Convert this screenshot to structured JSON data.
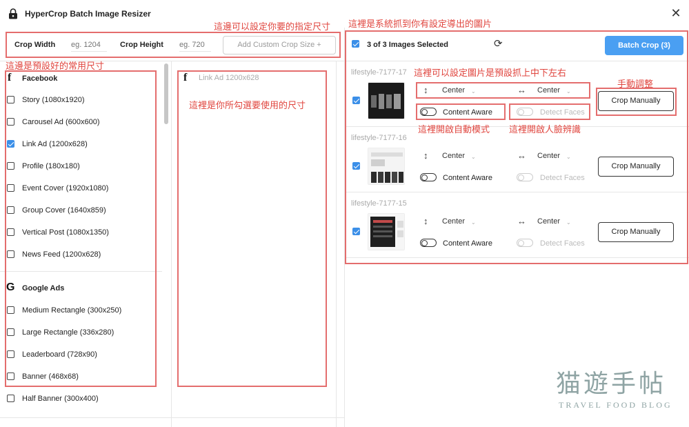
{
  "window": {
    "title": "HyperCrop Batch Image Resizer",
    "close_glyph": "✕"
  },
  "toolbar": {
    "crop_width_label": "Crop Width",
    "crop_width_placeholder": "eg. 1204",
    "crop_height_label": "Crop Height",
    "crop_height_placeholder": "eg. 720",
    "add_custom_label": "Add Custom Crop Size +"
  },
  "sizes": {
    "facebook": {
      "heading": "Facebook",
      "icon": "facebook-f-icon",
      "items": [
        {
          "label": "Story (1080x1920)",
          "checked": false
        },
        {
          "label": "Carousel Ad (600x600)",
          "checked": false
        },
        {
          "label": "Link Ad (1200x628)",
          "checked": true
        },
        {
          "label": "Profile (180x180)",
          "checked": false
        },
        {
          "label": "Event Cover (1920x1080)",
          "checked": false
        },
        {
          "label": "Group Cover (1640x859)",
          "checked": false
        },
        {
          "label": "Vertical Post (1080x1350)",
          "checked": false
        },
        {
          "label": "News Feed (1200x628)",
          "checked": false
        }
      ]
    },
    "google": {
      "heading": "Google Ads",
      "icon": "google-g-icon",
      "items": [
        {
          "label": "Medium Rectangle (300x250)",
          "checked": false
        },
        {
          "label": "Large Rectangle (336x280)",
          "checked": false
        },
        {
          "label": "Leaderboard (728x90)",
          "checked": false
        },
        {
          "label": "Banner (468x68)",
          "checked": false
        },
        {
          "label": "Half Banner (300x400)",
          "checked": false
        }
      ]
    }
  },
  "selected_sizes": {
    "item": "Link Ad 1200x628",
    "icon": "facebook-f-icon"
  },
  "images_panel": {
    "selection_text": "3 of 3 Images Selected",
    "batch_button": "Batch Crop (3)",
    "rows": [
      {
        "name": "lifestyle-7177-17",
        "vertical": "Center",
        "horizontal": "Center",
        "content_aware": "Content Aware",
        "detect_faces": "Detect Faces",
        "crop_button": "Crop Manually",
        "checked": true
      },
      {
        "name": "lifestyle-7177-16",
        "vertical": "Center",
        "horizontal": "Center",
        "content_aware": "Content Aware",
        "detect_faces": "Detect Faces",
        "crop_button": "Crop Manually",
        "checked": true
      },
      {
        "name": "lifestyle-7177-15",
        "vertical": "Center",
        "horizontal": "Center",
        "content_aware": "Content Aware",
        "detect_faces": "Detect Faces",
        "crop_button": "Crop Manually",
        "checked": true
      }
    ]
  },
  "annotations": {
    "custom_size": "這邊可以設定你要的指定尺寸",
    "images_grabbed": "這裡是系統抓到你有設定導出的圖片",
    "preset_sizes": "這邊是預設好的常用尺寸",
    "chosen_sizes": "這裡是你所勾選要使用的尺寸",
    "position": "這裡可以設定圖片是預設抓上中下左右",
    "manual": "手動調整",
    "content_aware": "這裡開啟自動模式",
    "detect_faces": "這裡開啟人臉辨識"
  },
  "watermark": {
    "main": "猫遊手帖",
    "sub": "TRAVEL FOOD BLOG"
  },
  "colors": {
    "accent": "#4a9ff2",
    "annotation": "#e46d6d",
    "annotation_text": "#e0463f"
  }
}
